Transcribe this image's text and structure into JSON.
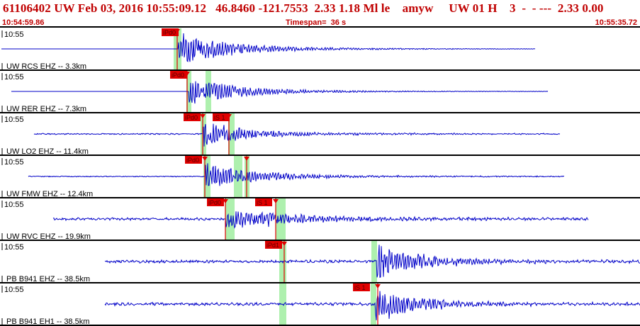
{
  "header": {
    "title": "61106402 UW Feb 03, 2016 10:55:09.12   46.8460 -121.7553  2.33 1.18 Ml le    amyw     UW 01 H    3  -  - ---  2.33 0.00",
    "time_start": "10:54:59.86",
    "timespan": "Timespan=  36 s",
    "time_end": "10:55:35.72"
  },
  "colors": {
    "header_text": "#c00000",
    "trace": "#0000c8",
    "pick_flag": "#e00000",
    "pick_window": "#aef0ae",
    "separator": "#000000"
  },
  "traces": [
    {
      "minute_label": "10:55",
      "station_label": "UW RCS EHZ -- 3.3km",
      "picks": [
        {
          "label": "iPd0"
        }
      ]
    },
    {
      "minute_label": "10:55",
      "station_label": "UW RER EHZ -- 7.3km",
      "picks": [
        {
          "label": "iPd0"
        }
      ]
    },
    {
      "minute_label": "10:55",
      "station_label": "UW LO2 EHZ -- 11.4km",
      "picks": [
        {
          "label": "iPd0"
        },
        {
          "label": "iS 1"
        }
      ]
    },
    {
      "minute_label": "10:55",
      "station_label": "UW FMW EHZ -- 12.4km",
      "picks": [
        {
          "label": "iPd0"
        }
      ]
    },
    {
      "minute_label": "10:55",
      "station_label": "UW RVC EHZ -- 19.9km",
      "picks": [
        {
          "label": "iPd0"
        },
        {
          "label": "iS 1"
        }
      ]
    },
    {
      "minute_label": "10:55",
      "station_label": "PB B941 EHZ -- 38.5km",
      "picks": [
        {
          "label": "iPd1"
        }
      ]
    },
    {
      "minute_label": "10:55",
      "station_label": "PB B941 EH1 -- 38.5km",
      "picks": [
        {
          "label": "iS 1"
        }
      ]
    }
  ]
}
